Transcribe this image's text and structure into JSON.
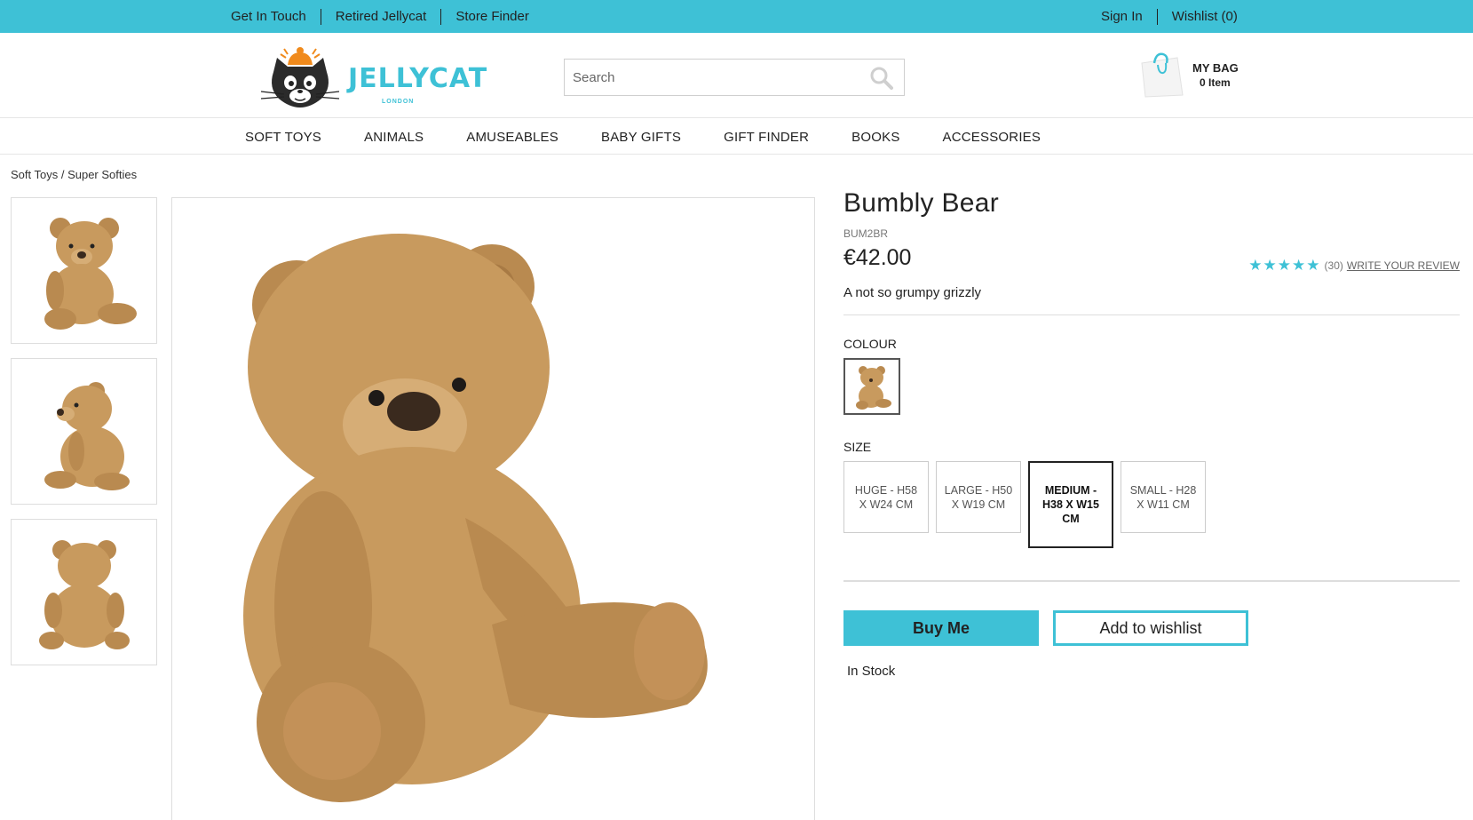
{
  "topbar": {
    "links_left": [
      "Get In Touch",
      "Retired Jellycat",
      "Store Finder"
    ],
    "links_right": [
      "Sign In",
      "Wishlist (0)"
    ]
  },
  "header": {
    "logo_text": "JELLYCAT",
    "logo_sub": "LONDON",
    "search_placeholder": "Search",
    "bag_title": "MY BAG",
    "bag_count": "0 Item"
  },
  "nav": {
    "items": [
      "SOFT TOYS",
      "ANIMALS",
      "AMUSEABLES",
      "BABY GIFTS",
      "GIFT FINDER",
      "BOOKS",
      "ACCESSORIES"
    ]
  },
  "breadcrumb": "Soft Toys / Super Softies",
  "product": {
    "title": "Bumbly Bear",
    "sku": "BUM2BR",
    "price": "€42.00",
    "rating_stars": 5,
    "review_count": "(30)",
    "review_link": "WRITE YOUR REVIEW",
    "description": "A not so grumpy grizzly",
    "colour_label": "COLOUR",
    "size_label": "SIZE",
    "sizes": [
      {
        "label": "HUGE - H58 X W24 CM",
        "selected": false
      },
      {
        "label": "LARGE - H50 X W19 CM",
        "selected": false
      },
      {
        "label": "MEDIUM - H38 X W15 CM",
        "selected": true
      },
      {
        "label": "SMALL - H28 X W11 CM",
        "selected": false
      }
    ],
    "buy_label": "Buy Me",
    "wishlist_label": "Add to wishlist",
    "stock": "In Stock"
  },
  "colors": {
    "accent": "#3ec1d6",
    "bear": "#c89a5e"
  },
  "icons": {
    "search": "search-icon",
    "bag": "shopping-bag-icon",
    "star": "star-icon"
  }
}
